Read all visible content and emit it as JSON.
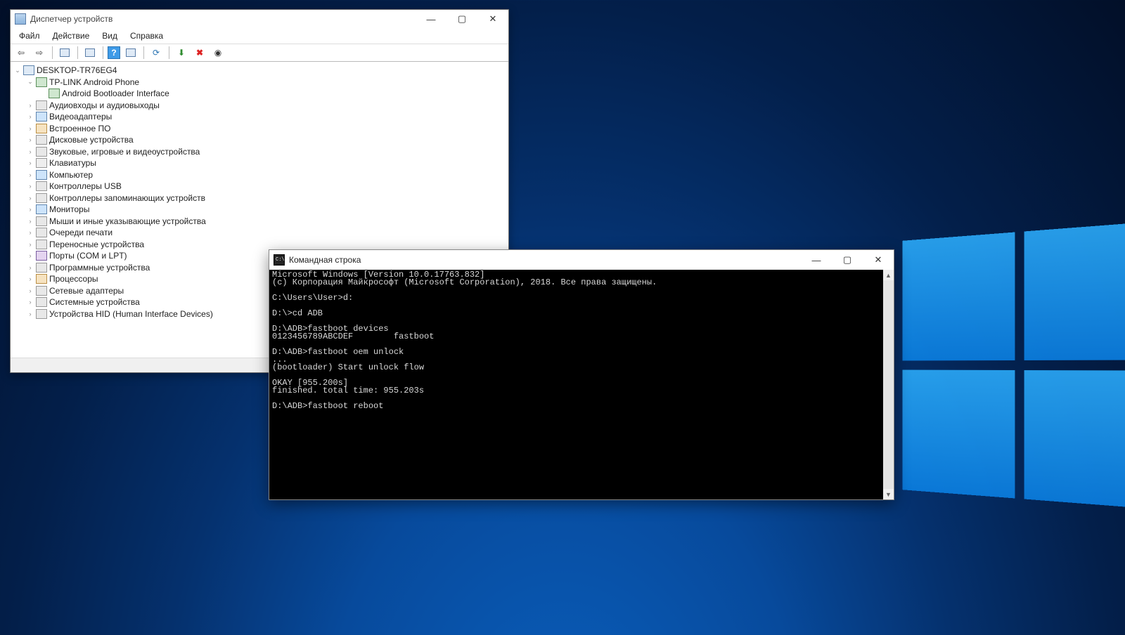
{
  "devmgr": {
    "title": "Диспетчер устройств",
    "menu": {
      "file": "Файл",
      "action": "Действие",
      "view": "Вид",
      "help": "Справка"
    },
    "root": "DESKTOP-TR76EG4",
    "phoneCategory": "TP-LINK Android Phone",
    "phoneDevice": "Android Bootloader Interface",
    "categories": [
      "Аудиовходы и аудиовыходы",
      "Видеоадаптеры",
      "Встроенное ПО",
      "Дисковые устройства",
      "Звуковые, игровые и видеоустройства",
      "Клавиатуры",
      "Компьютер",
      "Контроллеры USB",
      "Контроллеры запоминающих устройств",
      "Мониторы",
      "Мыши и иные указывающие устройства",
      "Очереди печати",
      "Переносные устройства",
      "Порты (COM и LPT)",
      "Программные устройства",
      "Процессоры",
      "Сетевые адаптеры",
      "Системные устройства",
      "Устройства HID (Human Interface Devices)"
    ]
  },
  "cmd": {
    "title": "Командная строка",
    "output": "Microsoft Windows [Version 10.0.17763.832]\n(c) Корпорация Майкрософт (Microsoft Corporation), 2018. Все права защищены.\n\nC:\\Users\\User>d:\n\nD:\\>cd ADB\n\nD:\\ADB>fastboot devices\n0123456789ABCDEF        fastboot\n\nD:\\ADB>fastboot oem unlock\n...\n(bootloader) Start unlock flow\n\nOKAY [955.200s]\nfinished. total time: 955.203s\n\nD:\\ADB>fastboot reboot"
  }
}
